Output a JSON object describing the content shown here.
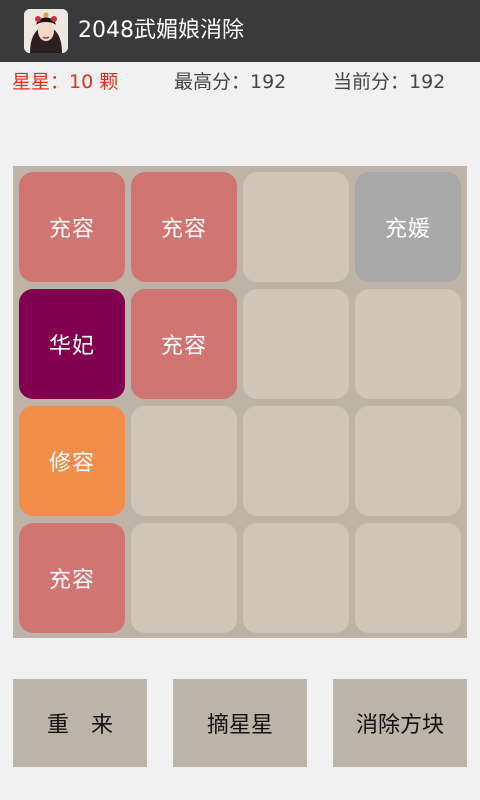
{
  "app": {
    "title": "2048武媚娘消除",
    "icon": "app-portrait-icon"
  },
  "stats": {
    "stars": "星星：10 颗",
    "best": "最高分：192",
    "current": "当前分：192"
  },
  "board": {
    "tiles": [
      {
        "text": "充容",
        "color": "#d07571"
      },
      {
        "text": "充容",
        "color": "#d07571"
      },
      {
        "text": "",
        "color": "#d1c5b7"
      },
      {
        "text": "充媛",
        "color": "#a9a9a9"
      },
      {
        "text": "华妃",
        "color": "#80004f"
      },
      {
        "text": "充容",
        "color": "#d07571"
      },
      {
        "text": "",
        "color": "#d1c5b7"
      },
      {
        "text": "",
        "color": "#d1c5b7"
      },
      {
        "text": "修容",
        "color": "#f28c4b"
      },
      {
        "text": "",
        "color": "#d1c5b7"
      },
      {
        "text": "",
        "color": "#d1c5b7"
      },
      {
        "text": "",
        "color": "#d1c5b7"
      },
      {
        "text": "充容",
        "color": "#d07571"
      },
      {
        "text": "",
        "color": "#d1c5b7"
      },
      {
        "text": "",
        "color": "#d1c5b7"
      },
      {
        "text": "",
        "color": "#d1c5b7"
      }
    ]
  },
  "buttons": {
    "restart": "重　来",
    "pick_star": "摘星星",
    "clear_tile": "消除方块"
  },
  "colors": {
    "titlebar": "#3a3a3a",
    "board": "#bdb3a7",
    "empty_tile": "#d1c5b7",
    "stars_text": "#e0301e",
    "button": "#bcb3a9"
  }
}
